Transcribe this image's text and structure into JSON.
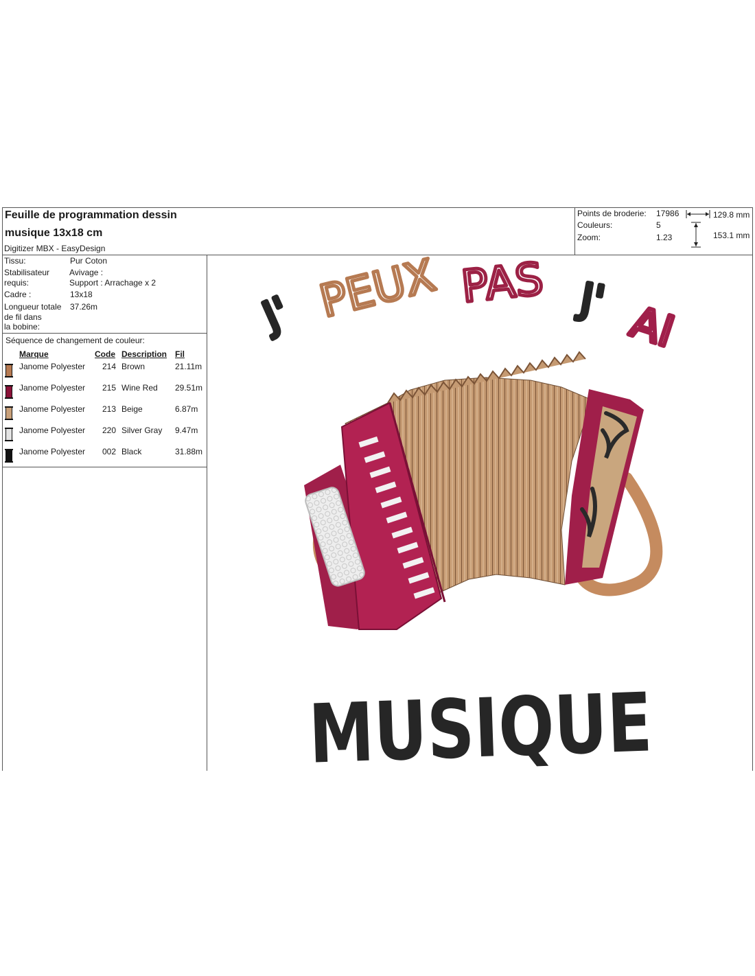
{
  "header": {
    "title_line1": "Feuille de programmation dessin",
    "title_line2": "musique 13x18 cm",
    "software": "Digitizer MBX - EasyDesign"
  },
  "stats": {
    "stitches_label": "Points de broderie:",
    "stitches_value": "17986",
    "colors_label": "Couleurs:",
    "colors_value": "5",
    "zoom_label": "Zoom:",
    "zoom_value": "1.23",
    "width": "129.8 mm",
    "height": "153.1 mm"
  },
  "specs": {
    "tissu_label": "Tissu:",
    "tissu_value": "Pur Coton",
    "stab_label_1": "Stabilisateur",
    "stab_label_2": "requis:",
    "stab_value_1": "Avivage :",
    "stab_value_2": "Support : Arrachage x 2",
    "cadre_label": "Cadre :",
    "cadre_value": "13x18",
    "longueur_label_1": "Longueur totale",
    "longueur_label_2": "de fil dans",
    "longueur_label_3": "la bobine:",
    "longueur_value": "37.26m"
  },
  "sequence": {
    "title": "Séquence de changement de couleur:",
    "headers": {
      "brand": "Marque",
      "code": "Code",
      "description": "Description",
      "thread": "Fil"
    },
    "rows": [
      {
        "brand": "Janome Polyester",
        "code": "214",
        "description": "Brown",
        "thread": "21.11m",
        "color": "#b67a52"
      },
      {
        "brand": "Janome Polyester",
        "code": "215",
        "description": "Wine Red",
        "thread": "29.51m",
        "color": "#8a1238"
      },
      {
        "brand": "Janome Polyester",
        "code": "213",
        "description": "Beige",
        "thread": "6.87m",
        "color": "#c8a07a"
      },
      {
        "brand": "Janome Polyester",
        "code": "220",
        "description": "Silver Gray",
        "thread": "9.47m",
        "color": "#e3e3e3"
      },
      {
        "brand": "Janome Polyester",
        "code": "002",
        "description": "Black",
        "thread": "31.88m",
        "color": "#111111"
      }
    ]
  },
  "design": {
    "word1": "J'",
    "word2": "PEUX",
    "word3": "PAS",
    "word4": "J'",
    "word5": "AI",
    "main_word": "MUSIQUE"
  }
}
